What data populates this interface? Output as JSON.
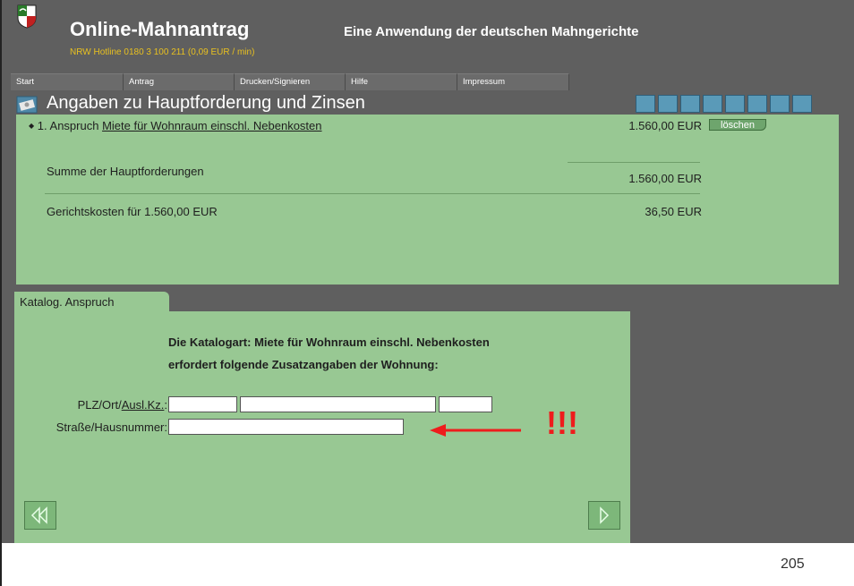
{
  "header": {
    "title": "Online-Mahnantrag",
    "subtitle": "Eine Anwendung der deutschen Mahngerichte",
    "hotline": "NRW Hotline 0180 3 100 211  (0,09 EUR / min)"
  },
  "menu": [
    "Start",
    "Antrag",
    "Drucken/Signieren",
    "Hilfe",
    "Impressum"
  ],
  "section": {
    "title": "Angaben zu Hauptforderung und Zinsen",
    "toolbar_icons": [
      "people-icon",
      "person-blue-icon",
      "person-purple-icon",
      "money-icon",
      "coins-icon",
      "list-icon",
      "document-icon",
      "save-icon"
    ]
  },
  "claims": {
    "bullet": "◆",
    "item_prefix": "1. Anspruch",
    "item_link": "Miete für Wohnraum einschl. Nebenkosten",
    "item_amount": "1.560,00 EUR",
    "delete_label": "löschen",
    "sum_label": "Summe der Hauptforderungen",
    "sum_amount": "1.560,00 EUR",
    "court_costs_label": "Gerichtskosten für 1.560,00 EUR",
    "court_costs_amount": "36,50 EUR"
  },
  "tab": {
    "label": "Katalog. Anspruch",
    "info_line1": "Die Katalogart: Miete für Wohnraum einschl. Nebenkosten",
    "info_line2": "erfordert folgende Zusatzangaben der Wohnung:",
    "plz_label_prefix": "PLZ/Ort/",
    "plz_label_link": "Ausl.Kz.",
    "plz_label_suffix": ":",
    "street_label": "Straße/Hausnummer:",
    "fields": {
      "plz": "",
      "ort": "",
      "ausl_kz": "",
      "strasse": ""
    }
  },
  "annotation": {
    "text": "!!!",
    "color": "#ee1c1c"
  },
  "colors": {
    "panel_green": "#98c893",
    "app_gray": "#5f5f5f"
  },
  "page_number": "205"
}
